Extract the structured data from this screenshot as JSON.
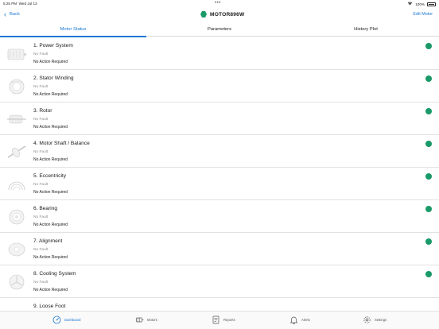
{
  "status_bar": {
    "time": "5:25 PM",
    "date": "Wed Jul 13",
    "battery": "100%",
    "dots": "•••"
  },
  "nav": {
    "back_label": "Back",
    "title": "MOTOR896W",
    "edit_label": "Edit Motor",
    "accent": "#1976d2",
    "brand": "#1a9a68"
  },
  "tabs": [
    {
      "label": "Motor Status",
      "active": true
    },
    {
      "label": "Parameters",
      "active": false
    },
    {
      "label": "History Plot",
      "active": false
    }
  ],
  "items": [
    {
      "title": "1. Power System",
      "fault": "No Fault",
      "action": "No Action Required",
      "status": "green",
      "icon": "motor-housing-icon"
    },
    {
      "title": "2. Stator Winding",
      "fault": "No Fault",
      "action": "No Action Required",
      "status": "green",
      "icon": "stator-winding-icon"
    },
    {
      "title": "3. Rotor",
      "fault": "No Fault",
      "action": "No Action Required",
      "status": "green",
      "icon": "rotor-icon"
    },
    {
      "title": "4. Motor Shaft / Balance",
      "fault": "No Fault",
      "action": "No Action Required",
      "status": "green",
      "icon": "motor-shaft-icon"
    },
    {
      "title": "5. Eccentricity",
      "fault": "No Fault",
      "action": "No Action Required",
      "status": "green",
      "icon": "eccentricity-icon"
    },
    {
      "title": "6. Bearing",
      "fault": "No Fault",
      "action": "No Action Required",
      "status": "green",
      "icon": "bearing-icon"
    },
    {
      "title": "7. Alignment",
      "fault": "No Fault",
      "action": "No Action Required",
      "status": "green",
      "icon": "alignment-icon"
    },
    {
      "title": "8. Cooling System",
      "fault": "No Fault",
      "action": "No Action Required",
      "status": "green",
      "icon": "cooling-system-icon"
    },
    {
      "title": "9. Loose Foot",
      "fault": "",
      "action": "",
      "status": "",
      "icon": "loose-foot-icon"
    }
  ],
  "bottom_tabs": [
    {
      "label": "Dashboard",
      "icon": "dashboard-icon",
      "active": true
    },
    {
      "label": "Motors",
      "icon": "motors-icon",
      "active": false
    },
    {
      "label": "Reports",
      "icon": "reports-icon",
      "active": false
    },
    {
      "label": "Alerts",
      "icon": "bell-icon",
      "active": false
    },
    {
      "label": "Settings",
      "icon": "gear-icon",
      "active": false
    }
  ]
}
